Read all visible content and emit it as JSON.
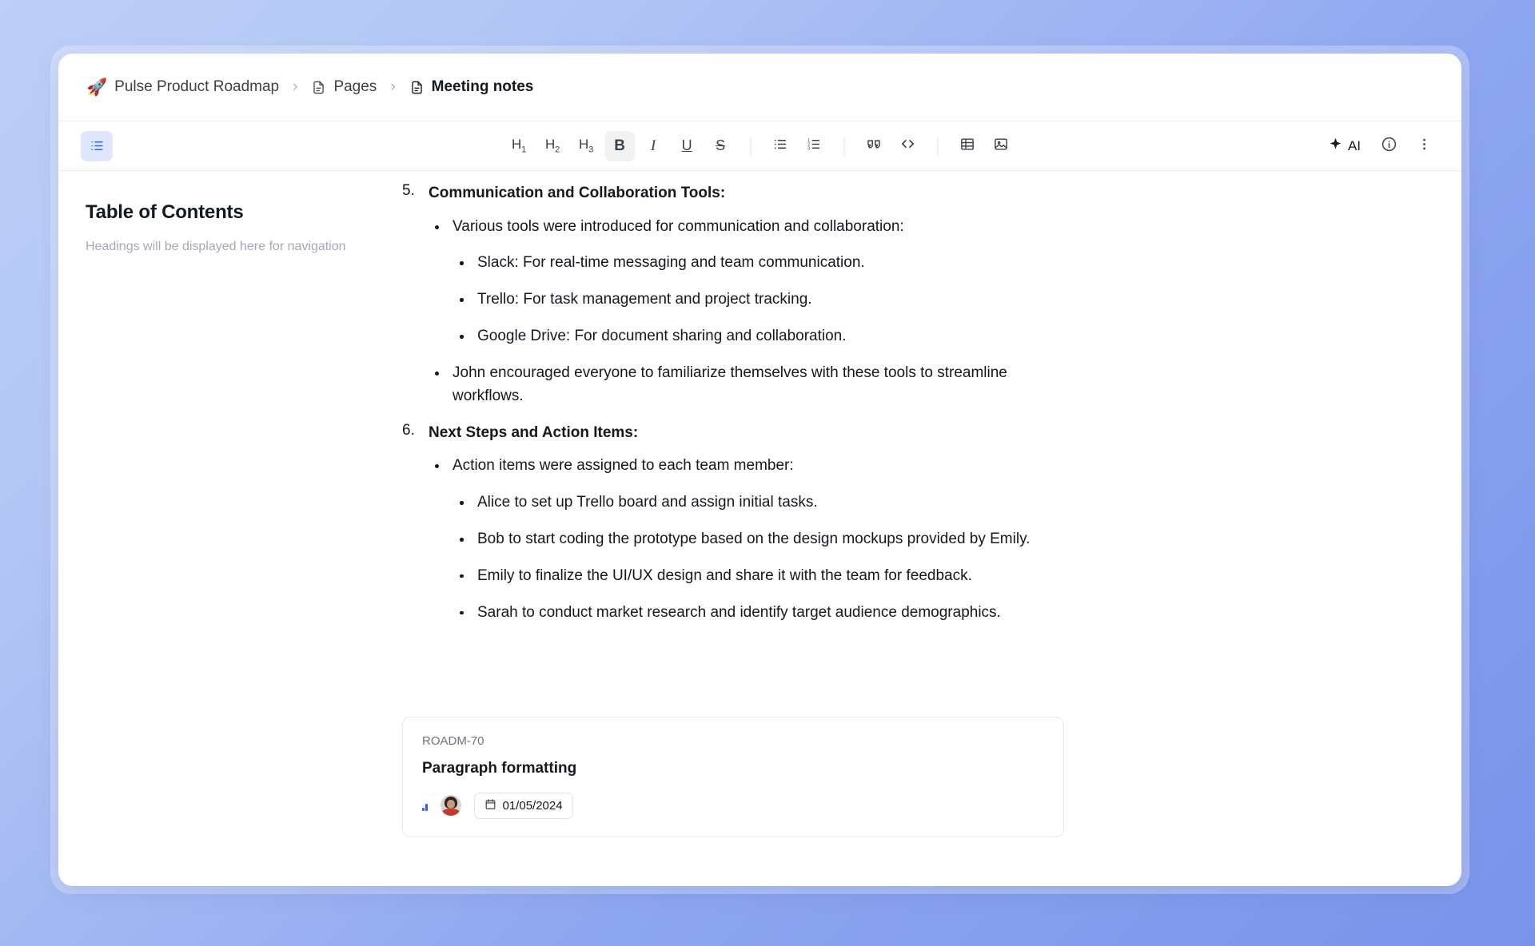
{
  "breadcrumb": {
    "items": [
      {
        "icon": "rocket-emoji",
        "emoji": "🚀",
        "label": "Pulse Product Roadmap"
      },
      {
        "icon": "document-icon",
        "label": "Pages"
      },
      {
        "icon": "document-icon",
        "label": "Meeting notes"
      }
    ],
    "separator": "›"
  },
  "toolbar": {
    "toc_toggle": "toc-list-icon",
    "heading_1": "H1",
    "heading_1_base": "H",
    "heading_1_sub": "1",
    "heading_2_base": "H",
    "heading_2_sub": "2",
    "heading_3_base": "H",
    "heading_3_sub": "3",
    "bold": "B",
    "italic": "I",
    "underline": "U",
    "strikethrough": "S",
    "bullet_list": "bullet-list-icon",
    "ordered_list": "ordered-list-icon",
    "blockquote": "quote-icon",
    "code_block": "code-icon",
    "table": "table-icon",
    "image": "image-icon",
    "ai_label": "AI",
    "info": "info-icon",
    "more": "more-vertical-icon"
  },
  "sidebar": {
    "title": "Table of Contents",
    "empty_message": "Headings will be displayed here for navigation"
  },
  "document": {
    "sections": [
      {
        "number": "5.",
        "heading": "Communication and Collaboration Tools:",
        "bullets": [
          {
            "text": "Various tools were introduced for communication and collaboration:",
            "children": [
              "Slack: For real-time messaging and team communication.",
              "Trello: For task management and project tracking.",
              "Google Drive: For document sharing and collaboration."
            ]
          },
          {
            "text": "John encouraged everyone to familiarize themselves with these tools to streamline workflows.",
            "children": []
          }
        ]
      },
      {
        "number": "6.",
        "heading": "Next Steps and Action Items:",
        "bullets": [
          {
            "text": "Action items were assigned to each team member:",
            "children": [
              "Alice to set up Trello board and assign initial tasks.",
              "Bob to start coding the prototype based on the design mockups provided by Emily.",
              "Emily to finalize the UI/UX design and share it with the team for feedback.",
              "Sarah to conduct market research and identify target audience demographics."
            ]
          }
        ]
      }
    ]
  },
  "task_card": {
    "key": "ROADM-70",
    "title": "Paragraph formatting",
    "priority": "priority-bars-icon",
    "assignee": "assignee-avatar",
    "date": "01/05/2024"
  },
  "colors": {
    "accent": "#2f62ed",
    "toc_toggle_bg": "#dfe6fd",
    "background_start": "#bdcff7",
    "background_end": "#7a93ea",
    "text_primary": "#14181f",
    "text_muted": "#a3a9b4"
  }
}
